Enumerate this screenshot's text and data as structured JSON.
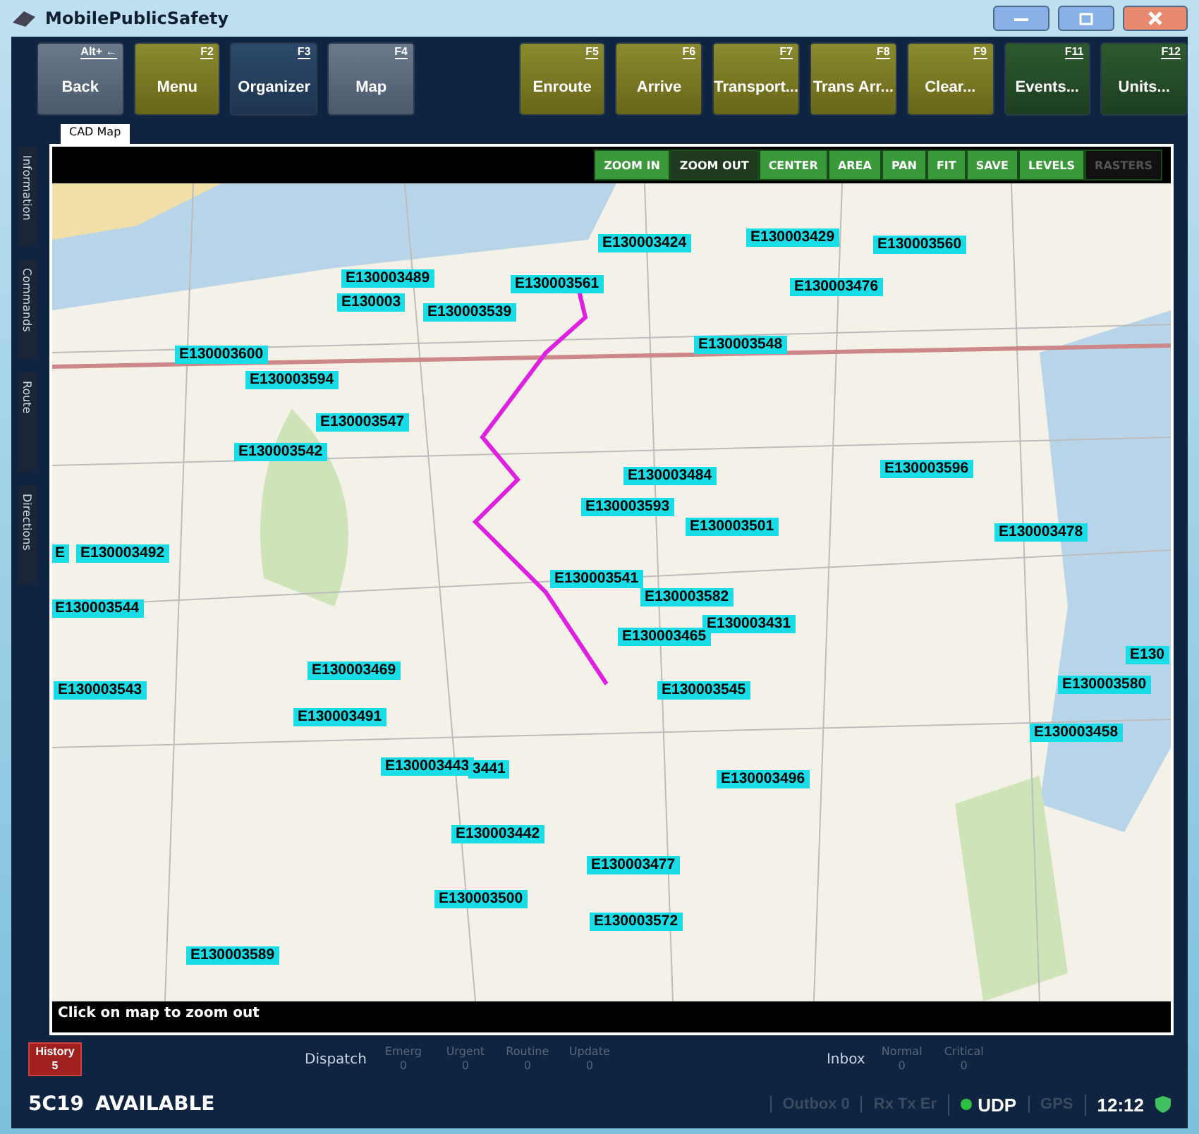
{
  "window": {
    "title": "MobilePublicSafety"
  },
  "toolbar": {
    "left_buttons": [
      {
        "key": "Alt+ ←",
        "label": "Back",
        "kind": "navigation"
      },
      {
        "key": "F2",
        "label": "Menu",
        "kind": "status"
      },
      {
        "key": "F3",
        "label": "Organizer",
        "kind": "organizer"
      },
      {
        "key": "F4",
        "label": "Map",
        "kind": "navigation"
      }
    ],
    "right_buttons": [
      {
        "key": "F5",
        "label": "Enroute",
        "kind": "status"
      },
      {
        "key": "F6",
        "label": "Arrive",
        "kind": "status"
      },
      {
        "key": "F7",
        "label": "Transport...",
        "kind": "status"
      },
      {
        "key": "F8",
        "label": "Trans Arr...",
        "kind": "status"
      },
      {
        "key": "F9",
        "label": "Clear...",
        "kind": "status"
      },
      {
        "key": "F11",
        "label": "Events...",
        "kind": "list"
      },
      {
        "key": "F12",
        "label": "Units...",
        "kind": "list"
      }
    ]
  },
  "tabs": [
    {
      "label": "CAD Map",
      "selected": true
    }
  ],
  "side_tabs": [
    {
      "label": "Information"
    },
    {
      "label": "Commands"
    },
    {
      "label": "Route"
    },
    {
      "label": "Directions"
    }
  ],
  "map_toolbar": [
    {
      "label": "ZOOM IN",
      "selected": false,
      "disabled": false
    },
    {
      "label": "ZOOM OUT",
      "selected": true,
      "disabled": false
    },
    {
      "label": "CENTER",
      "selected": false,
      "disabled": false
    },
    {
      "label": "AREA",
      "selected": false,
      "disabled": false
    },
    {
      "label": "PAN",
      "selected": false,
      "disabled": false
    },
    {
      "label": "FIT",
      "selected": false,
      "disabled": false
    },
    {
      "label": "SAVE",
      "selected": false,
      "disabled": false
    },
    {
      "label": "LEVELS",
      "selected": false,
      "disabled": false
    },
    {
      "label": "RASTERS",
      "selected": false,
      "disabled": true
    }
  ],
  "map": {
    "incidents": [
      "E130003424",
      "E130003429",
      "E130003560",
      "E130003489",
      "E130003561",
      "E130003476",
      "E130003",
      "E130003539",
      "E130003548",
      "E130003600",
      "E130003594",
      "E130003547",
      "E130003542",
      "E130003596",
      "E130003484",
      "E130003593",
      "E130003501",
      "E130003478",
      "E",
      "E130003492",
      "E130003541",
      "E130003582",
      "E130003544",
      "E130003431",
      "E130003465",
      "E130",
      "E130003469",
      "E130003580",
      "E130003543",
      "E130003545",
      "E130003491",
      "E130003458",
      "E130003443",
      "3441",
      "E130003496",
      "E130003442",
      "E130003477",
      "E130003500",
      "E130003572",
      "E130003589"
    ],
    "hint": "Click on map to zoom out"
  },
  "status": {
    "history": {
      "label": "History",
      "count": "5"
    },
    "dispatch": {
      "label": "Dispatch",
      "counters": [
        {
          "label": "Emerg",
          "value": "0"
        },
        {
          "label": "Urgent",
          "value": "0"
        },
        {
          "label": "Routine",
          "value": "0"
        },
        {
          "label": "Update",
          "value": "0"
        }
      ]
    },
    "inbox": {
      "label": "Inbox",
      "counters": [
        {
          "label": "Normal",
          "value": "0"
        },
        {
          "label": "Critical",
          "value": "0"
        }
      ]
    },
    "unit": "5C19",
    "unit_status": "AVAILABLE",
    "indicators": [
      {
        "label": "Outbox 0",
        "on": false
      },
      {
        "label": "Rx  Tx  Er",
        "on": false
      },
      {
        "label": "UDP",
        "on": true
      },
      {
        "label": "GPS",
        "on": false
      }
    ],
    "time": "12:12"
  }
}
